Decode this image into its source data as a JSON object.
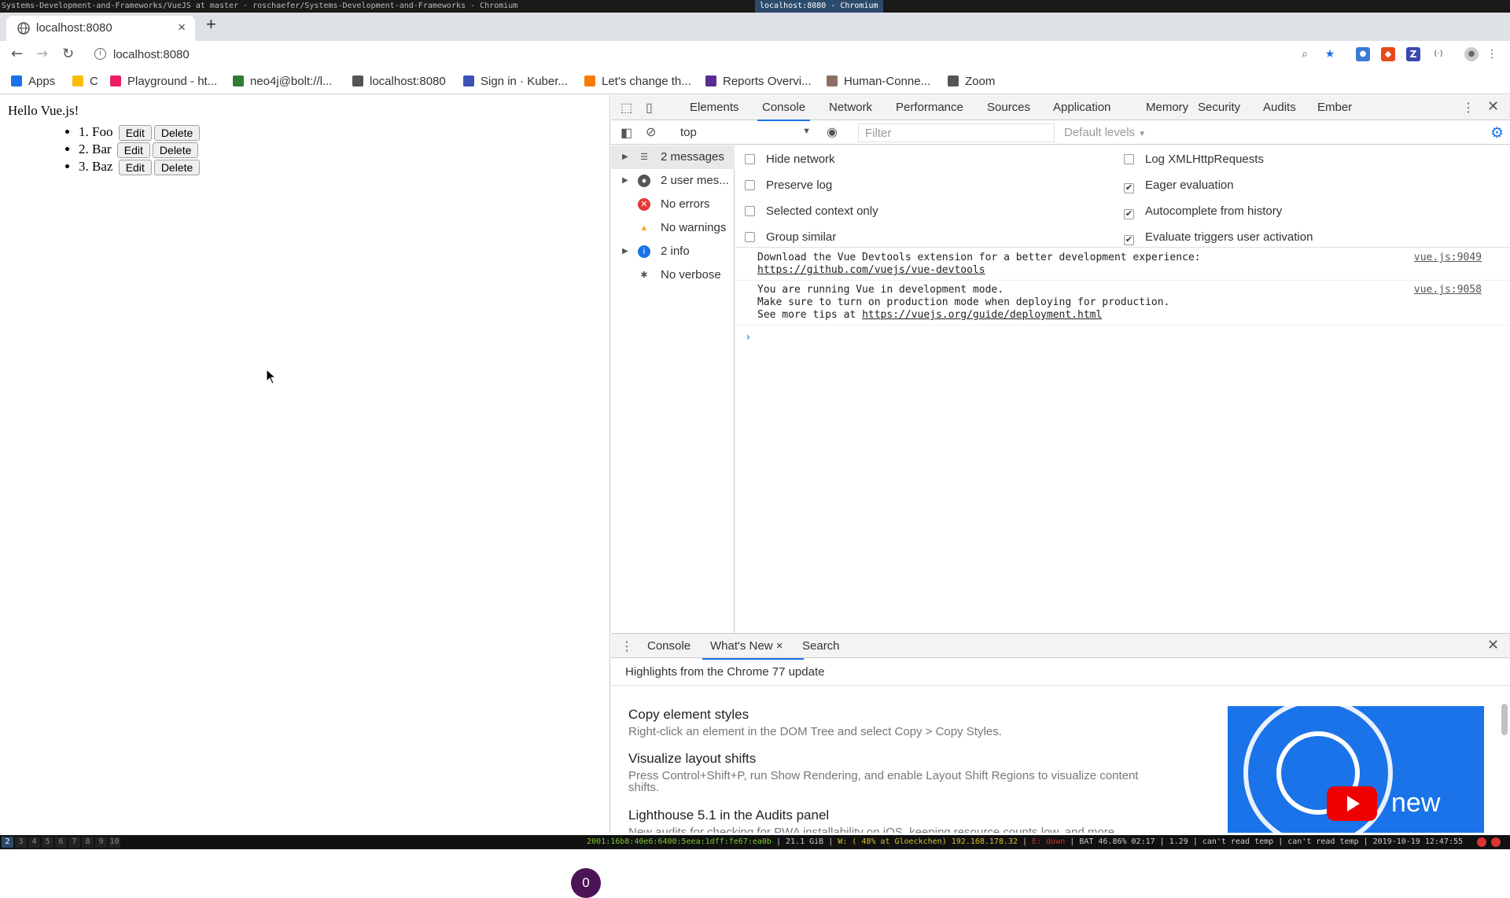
{
  "wm": {
    "title_left": "Systems-Development-and-Frameworks/VueJS at master · roschaefer/Systems-Development-and-Frameworks - Chromium",
    "title_right": "localhost:8080 - Chromium"
  },
  "browser": {
    "tab_title": "localhost:8080",
    "tab_close": "×",
    "new_tab": "+",
    "url": "localhost:8080",
    "bookmarks": [
      {
        "label": "Apps",
        "color": "#1a73e8"
      },
      {
        "label": "C",
        "color": "#fbbc05"
      },
      {
        "label": "Playground - ht...",
        "color": "#e91e63"
      },
      {
        "label": "neo4j@bolt://l...",
        "color": "#2e7d32"
      },
      {
        "label": "localhost:8080",
        "color": "#555555"
      },
      {
        "label": "Sign in · Kuber...",
        "color": "#3f51b5"
      },
      {
        "label": "Let's change th...",
        "color": "#f57c00"
      },
      {
        "label": "Reports Overvi...",
        "color": "#5c2d91"
      },
      {
        "label": "Human-Conne...",
        "color": "#8d6e63"
      },
      {
        "label": "Zoom",
        "color": "#555555"
      }
    ]
  },
  "app": {
    "heading": "Hello Vue.js!",
    "items": [
      {
        "label": "1. Foo",
        "edit": "Edit",
        "delete": "Delete"
      },
      {
        "label": "2. Bar",
        "edit": "Edit",
        "delete": "Delete"
      },
      {
        "label": "3. Baz",
        "edit": "Edit",
        "delete": "Delete"
      }
    ],
    "bubble_count": "0"
  },
  "devtools": {
    "tabs": [
      "Elements",
      "Console",
      "Network",
      "Performance",
      "Sources",
      "Application",
      "Memory",
      "Security",
      "Audits",
      "Ember"
    ],
    "active_tab": "Console",
    "context": "top",
    "filter_placeholder": "Filter",
    "levels": "Default levels",
    "sidebar": [
      {
        "label": "2 messages",
        "icon": "list-icon",
        "expandable": true,
        "selected": true
      },
      {
        "label": "2 user mes...",
        "icon": "user-icon",
        "expandable": true,
        "selected": false
      },
      {
        "label": "No errors",
        "icon": "error-icon",
        "expandable": false,
        "selected": false
      },
      {
        "label": "No warnings",
        "icon": "warning-icon",
        "expandable": false,
        "selected": false
      },
      {
        "label": "2 info",
        "icon": "info-icon",
        "expandable": true,
        "selected": false
      },
      {
        "label": "No verbose",
        "icon": "bug-icon",
        "expandable": false,
        "selected": false
      }
    ],
    "settings_left": [
      {
        "label": "Hide network",
        "checked": false
      },
      {
        "label": "Preserve log",
        "checked": false
      },
      {
        "label": "Selected context only",
        "checked": false
      },
      {
        "label": "Group similar",
        "checked": false
      }
    ],
    "settings_right": [
      {
        "label": "Log XMLHttpRequests",
        "checked": false
      },
      {
        "label": "Eager evaluation",
        "checked": true
      },
      {
        "label": "Autocomplete from history",
        "checked": true
      },
      {
        "label": "Evaluate triggers user activation",
        "checked": true
      }
    ],
    "messages": [
      {
        "line1": "Download the Vue Devtools extension for a better development experience:",
        "link": "https://github.com/vuejs/vue-devtools",
        "source": "vue.js:9049"
      },
      {
        "line1": "You are running Vue in development mode.",
        "line2": "Make sure to turn on production mode when deploying for production.",
        "line3_prefix": "See more tips at ",
        "link": "https://vuejs.org/guide/deployment.html",
        "source": "vue.js:9058"
      }
    ],
    "prompt": "›",
    "drawer_tabs": [
      "Console",
      "What's New",
      "Search"
    ],
    "drawer_active": "What's New",
    "highlights": "Highlights from the Chrome 77 update",
    "features": [
      {
        "title": "Copy element styles",
        "desc": "Right-click an element in the DOM Tree and select Copy > Copy Styles."
      },
      {
        "title": "Visualize layout shifts",
        "desc": "Press Control+Shift+P, run Show Rendering, and enable Layout Shift Regions to visualize content shifts."
      },
      {
        "title": "Lighthouse 5.1 in the Audits panel",
        "desc": "New audits for checking for PWA installability on iOS, keeping resource counts low, and more."
      }
    ],
    "banner_text": "new"
  },
  "statusbar": {
    "workspaces": [
      "2",
      "3",
      "4",
      "5",
      "6",
      "7",
      "8",
      "9",
      "10"
    ],
    "ipv6": "2001:16b8:40e6:6400:5eea:1dff:fe67:ea0b",
    "disk": "21.1 GiB",
    "wifi": "W: ( 48% at Gloeckchen) 192.168.178.32",
    "eth": "E: down",
    "bat": "BAT 46.86% 02:17",
    "load": "1.29",
    "temp1": "can't read temp",
    "temp2": "can't read temp",
    "datetime": "2019-10-19 12:47:55"
  }
}
